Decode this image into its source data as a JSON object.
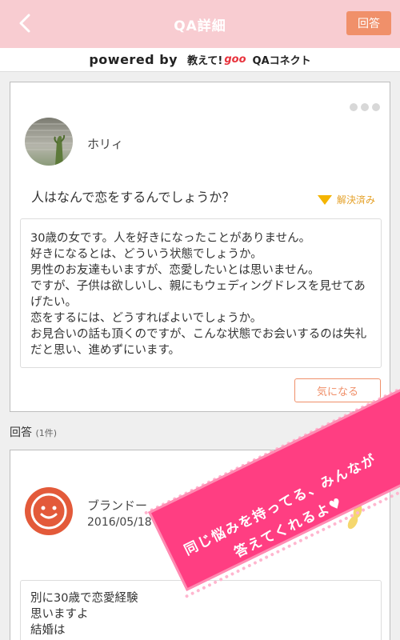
{
  "header": {
    "title": "QA詳細",
    "answer_label": "回答"
  },
  "powered": {
    "by": "powered by",
    "brand_pre": "教えて!",
    "brand_goo": "goo",
    "brand_post": "QAコネクト"
  },
  "question": {
    "user": "ホリィ",
    "title": "人はなんで恋をするんでしょうか？",
    "status": "解決済み",
    "body": "30歳の女です。人を好きになったことがありません。\n好きになるとは、どういう状態でしょうか。\n男性のお友達もいますが、恋愛したいとは思いません。\nですが、子供は欲しいし、親にもウェディングドレスを見せてあげたい。\n恋をするには、どうすればよいでしょうか。\nお見合いの話も頂くのですが、こんな状態でお会いするのは失礼だと思い、進めずにいます。",
    "watch_label": "気になる"
  },
  "answers": {
    "heading": "回答",
    "count": "(1件)"
  },
  "answer": {
    "user": "ブランドー",
    "date": "2016/05/18 19:52",
    "body": "別に30歳で恋愛経験\n思いますよ\n結婚は"
  },
  "banner": {
    "line1": "同じ悩みを持ってる、みんなが",
    "line2": "答えてくれるよ♥"
  },
  "colors": {
    "header_bg": "#f8ccd1",
    "accent": "#f0906a",
    "resolved": "#f4b400",
    "avatar": "#e35a3a",
    "banner": "#ff3e82"
  }
}
